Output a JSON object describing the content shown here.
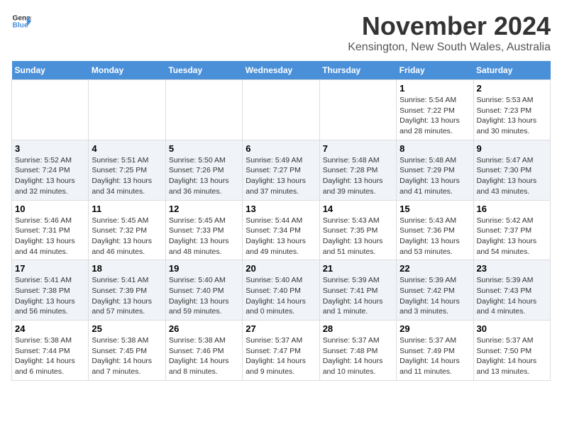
{
  "header": {
    "logo_line1": "General",
    "logo_line2": "Blue",
    "month_title": "November 2024",
    "location": "Kensington, New South Wales, Australia"
  },
  "days_of_week": [
    "Sunday",
    "Monday",
    "Tuesday",
    "Wednesday",
    "Thursday",
    "Friday",
    "Saturday"
  ],
  "weeks": [
    [
      {
        "day": "",
        "info": ""
      },
      {
        "day": "",
        "info": ""
      },
      {
        "day": "",
        "info": ""
      },
      {
        "day": "",
        "info": ""
      },
      {
        "day": "",
        "info": ""
      },
      {
        "day": "1",
        "info": "Sunrise: 5:54 AM\nSunset: 7:22 PM\nDaylight: 13 hours\nand 28 minutes."
      },
      {
        "day": "2",
        "info": "Sunrise: 5:53 AM\nSunset: 7:23 PM\nDaylight: 13 hours\nand 30 minutes."
      }
    ],
    [
      {
        "day": "3",
        "info": "Sunrise: 5:52 AM\nSunset: 7:24 PM\nDaylight: 13 hours\nand 32 minutes."
      },
      {
        "day": "4",
        "info": "Sunrise: 5:51 AM\nSunset: 7:25 PM\nDaylight: 13 hours\nand 34 minutes."
      },
      {
        "day": "5",
        "info": "Sunrise: 5:50 AM\nSunset: 7:26 PM\nDaylight: 13 hours\nand 36 minutes."
      },
      {
        "day": "6",
        "info": "Sunrise: 5:49 AM\nSunset: 7:27 PM\nDaylight: 13 hours\nand 37 minutes."
      },
      {
        "day": "7",
        "info": "Sunrise: 5:48 AM\nSunset: 7:28 PM\nDaylight: 13 hours\nand 39 minutes."
      },
      {
        "day": "8",
        "info": "Sunrise: 5:48 AM\nSunset: 7:29 PM\nDaylight: 13 hours\nand 41 minutes."
      },
      {
        "day": "9",
        "info": "Sunrise: 5:47 AM\nSunset: 7:30 PM\nDaylight: 13 hours\nand 43 minutes."
      }
    ],
    [
      {
        "day": "10",
        "info": "Sunrise: 5:46 AM\nSunset: 7:31 PM\nDaylight: 13 hours\nand 44 minutes."
      },
      {
        "day": "11",
        "info": "Sunrise: 5:45 AM\nSunset: 7:32 PM\nDaylight: 13 hours\nand 46 minutes."
      },
      {
        "day": "12",
        "info": "Sunrise: 5:45 AM\nSunset: 7:33 PM\nDaylight: 13 hours\nand 48 minutes."
      },
      {
        "day": "13",
        "info": "Sunrise: 5:44 AM\nSunset: 7:34 PM\nDaylight: 13 hours\nand 49 minutes."
      },
      {
        "day": "14",
        "info": "Sunrise: 5:43 AM\nSunset: 7:35 PM\nDaylight: 13 hours\nand 51 minutes."
      },
      {
        "day": "15",
        "info": "Sunrise: 5:43 AM\nSunset: 7:36 PM\nDaylight: 13 hours\nand 53 minutes."
      },
      {
        "day": "16",
        "info": "Sunrise: 5:42 AM\nSunset: 7:37 PM\nDaylight: 13 hours\nand 54 minutes."
      }
    ],
    [
      {
        "day": "17",
        "info": "Sunrise: 5:41 AM\nSunset: 7:38 PM\nDaylight: 13 hours\nand 56 minutes."
      },
      {
        "day": "18",
        "info": "Sunrise: 5:41 AM\nSunset: 7:39 PM\nDaylight: 13 hours\nand 57 minutes."
      },
      {
        "day": "19",
        "info": "Sunrise: 5:40 AM\nSunset: 7:40 PM\nDaylight: 13 hours\nand 59 minutes."
      },
      {
        "day": "20",
        "info": "Sunrise: 5:40 AM\nSunset: 7:40 PM\nDaylight: 14 hours\nand 0 minutes."
      },
      {
        "day": "21",
        "info": "Sunrise: 5:39 AM\nSunset: 7:41 PM\nDaylight: 14 hours\nand 1 minute."
      },
      {
        "day": "22",
        "info": "Sunrise: 5:39 AM\nSunset: 7:42 PM\nDaylight: 14 hours\nand 3 minutes."
      },
      {
        "day": "23",
        "info": "Sunrise: 5:39 AM\nSunset: 7:43 PM\nDaylight: 14 hours\nand 4 minutes."
      }
    ],
    [
      {
        "day": "24",
        "info": "Sunrise: 5:38 AM\nSunset: 7:44 PM\nDaylight: 14 hours\nand 6 minutes."
      },
      {
        "day": "25",
        "info": "Sunrise: 5:38 AM\nSunset: 7:45 PM\nDaylight: 14 hours\nand 7 minutes."
      },
      {
        "day": "26",
        "info": "Sunrise: 5:38 AM\nSunset: 7:46 PM\nDaylight: 14 hours\nand 8 minutes."
      },
      {
        "day": "27",
        "info": "Sunrise: 5:37 AM\nSunset: 7:47 PM\nDaylight: 14 hours\nand 9 minutes."
      },
      {
        "day": "28",
        "info": "Sunrise: 5:37 AM\nSunset: 7:48 PM\nDaylight: 14 hours\nand 10 minutes."
      },
      {
        "day": "29",
        "info": "Sunrise: 5:37 AM\nSunset: 7:49 PM\nDaylight: 14 hours\nand 11 minutes."
      },
      {
        "day": "30",
        "info": "Sunrise: 5:37 AM\nSunset: 7:50 PM\nDaylight: 14 hours\nand 13 minutes."
      }
    ]
  ]
}
